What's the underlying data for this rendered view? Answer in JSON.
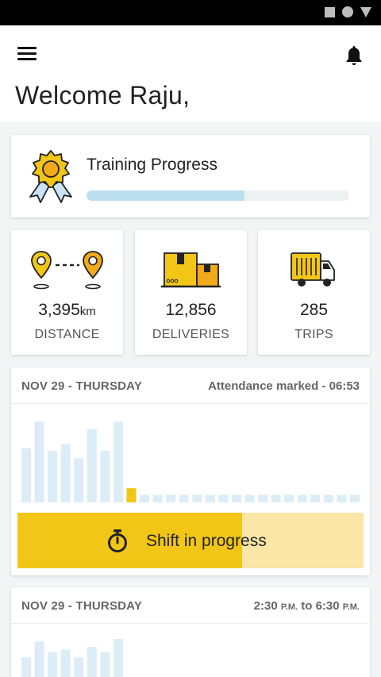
{
  "header": {
    "welcome": "Welcome Raju,",
    "menu_icon": "hamburger-menu-icon",
    "notification_icon": "bell-icon"
  },
  "training": {
    "title": "Training Progress",
    "progress": 0.6,
    "icon": "medal-icon"
  },
  "stats": [
    {
      "value": "3,395",
      "unit": "km",
      "label": "DISTANCE",
      "icon": "route-pins-icon"
    },
    {
      "value": "12,856",
      "unit": "",
      "label": "DELIVERIES",
      "icon": "boxes-icon"
    },
    {
      "value": "285",
      "unit": "",
      "label": "TRIPS",
      "icon": "truck-icon"
    }
  ],
  "shift_today": {
    "date": "NOV 29 - THURSDAY",
    "status": "Attendance marked - 06:53",
    "button_label": "Shift in progress",
    "progress": 0.65,
    "chart_values": [
      65,
      97,
      62,
      70,
      53,
      88,
      62,
      97,
      17,
      9,
      9,
      9,
      9,
      9,
      9,
      9,
      9,
      9,
      9,
      9,
      9,
      9,
      9,
      9,
      9,
      9
    ],
    "active_index": 8
  },
  "shift_next": {
    "date": "NOV 29 - THURSDAY",
    "start": "2:30",
    "start_suffix": "P.M.",
    "to": "to",
    "end": "6:30",
    "end_suffix": "P.M.",
    "chart_values": [
      40,
      70,
      50,
      55,
      40,
      60,
      50,
      75
    ]
  },
  "colors": {
    "accent": "#f2c617",
    "accent_light": "#fae6a6",
    "bar_light": "#dcedf7",
    "progress_fill": "#bcdff0"
  }
}
